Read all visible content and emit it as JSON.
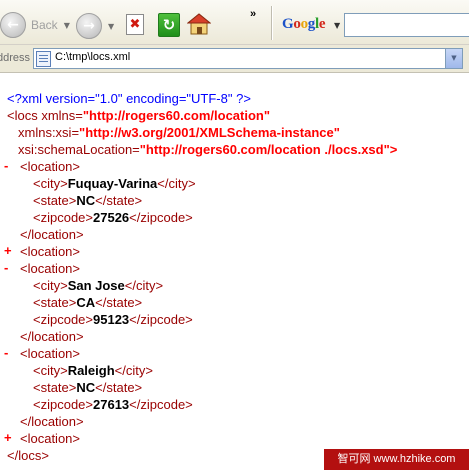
{
  "toolbar": {
    "back_label": "Back",
    "google_parts": [
      "G",
      "o",
      "o",
      "g",
      "l",
      "e"
    ]
  },
  "address": {
    "label": "ddress",
    "url": "C:\\tmp\\locs.xml"
  },
  "xml": {
    "pi": "<?xml version=\"1.0\" encoding=\"UTF-8\" ?>",
    "root_open": "<locs",
    "xmlns_attr": "xmlns=",
    "xmlns_val": "\"http://rogers60.com/location\"",
    "xsi_attr": "xmlns:xsi=",
    "xsi_val": "\"http://w3.org/2001/XMLSchema-instance\"",
    "schema_attr": "xsi:schemaLocation=",
    "schema_val": "\"http://rogers60.com/location ./locs.xsd\">",
    "location_open": "<location>",
    "location_close": "</location>",
    "root_close": "</locs>",
    "city_open": "<city>",
    "city_close": "</city>",
    "state_open": "<state>",
    "state_close": "</state>",
    "zip_open": "<zipcode>",
    "zip_close": "</zipcode>",
    "toggle_minus": "-",
    "toggle_plus": "+",
    "locations": [
      {
        "city": "Fuquay-Varina",
        "state": "NC",
        "zipcode": "27526"
      },
      {
        "city": "San Jose",
        "state": "CA",
        "zipcode": "95123"
      },
      {
        "city": "Raleigh",
        "state": "NC",
        "zipcode": "27613"
      }
    ]
  },
  "watermark": "智可网 www.hzhike.com"
}
